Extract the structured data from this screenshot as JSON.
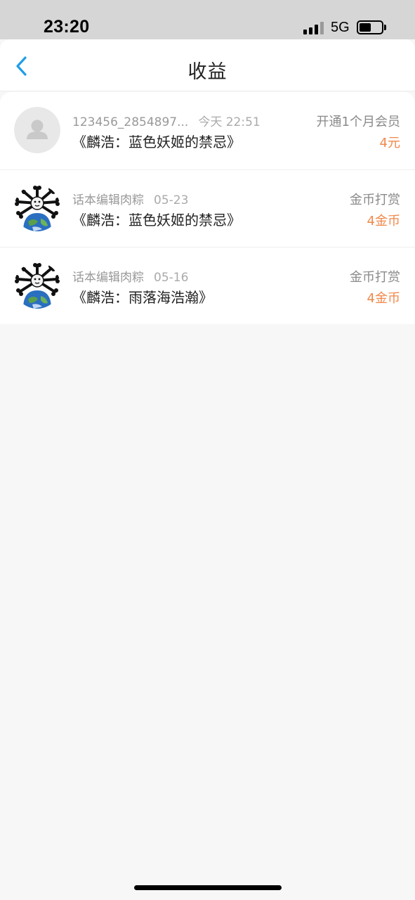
{
  "status_bar": {
    "time": "23:20",
    "network": "5G"
  },
  "header": {
    "title": "收益",
    "back_icon": "chevron-left-icon",
    "accent_color": "#1f9ee6"
  },
  "earnings": [
    {
      "user": "123456_2854897...",
      "time": "今天 22:51",
      "book": "《麟浩：蓝色妖姬的禁忌》",
      "type": "开通1个月会员",
      "amount": "4元",
      "avatar": "default-user-icon"
    },
    {
      "user": "话本编辑肉粽",
      "time": "05-23",
      "book": "《麟浩：蓝色妖姬的禁忌》",
      "type": "金币打赏",
      "amount": "4金币",
      "avatar": "bone-earth-avatar"
    },
    {
      "user": "话本编辑肉粽",
      "time": "05-16",
      "book": "《麟浩：雨落海浩瀚》",
      "type": "金币打赏",
      "amount": "4金币",
      "avatar": "bone-earth-avatar"
    }
  ],
  "colors": {
    "amount": "#f0884a",
    "background": "#f7f7f7"
  }
}
